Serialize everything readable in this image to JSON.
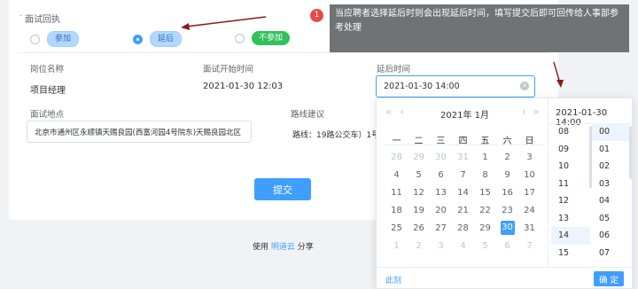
{
  "form": {
    "section_title": "面试回执",
    "radios": [
      {
        "label": "参加",
        "checked": false
      },
      {
        "label": "延后",
        "checked": true
      },
      {
        "label": "不参加",
        "checked": false
      }
    ],
    "position_label": "岗位名称",
    "position_value": "项目经理",
    "start_label": "面试开始时间",
    "start_value": "2021-01-30 12:03",
    "delay_label": "延后时间",
    "delay_value": "2021-01-30 14:00",
    "location_label": "面试地点",
    "location_value": "北京市通州区永顺镇天赐良园(西富河园4号院东)天赐良园北区",
    "route_label": "路线建议",
    "route_value": "路线：19路公交车）1号",
    "submit_label": "提交"
  },
  "footer": {
    "prefix": "使用",
    "link": "明道云",
    "suffix": "分享"
  },
  "tooltip": {
    "badge": "1",
    "text": "当应聘者选择延后时则会出现延后时间，填写提交后即可回传给人事部参考处理"
  },
  "picker": {
    "year_month": "2021年 1月",
    "weekdays": [
      "一",
      "二",
      "三",
      "四",
      "五",
      "六",
      "日"
    ],
    "weeks": [
      [
        "28",
        "29",
        "30",
        "31",
        "1",
        "2",
        "3"
      ],
      [
        "4",
        "5",
        "6",
        "7",
        "8",
        "9",
        "10"
      ],
      [
        "11",
        "12",
        "13",
        "14",
        "15",
        "16",
        "17"
      ],
      [
        "18",
        "19",
        "20",
        "21",
        "22",
        "23",
        "24"
      ],
      [
        "25",
        "26",
        "27",
        "28",
        "29",
        "30",
        "31"
      ],
      [
        "1",
        "2",
        "3",
        "4",
        "5",
        "6",
        "7"
      ]
    ],
    "selected_day": "30",
    "time_header": "2021-01-30 14:00",
    "hours": [
      "08",
      "09",
      "10",
      "11",
      "12",
      "13",
      "14",
      "15"
    ],
    "selected_hour": "14",
    "minutes": [
      "00",
      "01",
      "02",
      "03",
      "04",
      "05",
      "06",
      "07"
    ],
    "selected_minute": "00",
    "now_label": "此刻",
    "ok_label": "确 定"
  },
  "colors": {
    "accent": "#409eff",
    "arrow": "#8b1a1a",
    "tooltip_bg": "#6f7376"
  }
}
